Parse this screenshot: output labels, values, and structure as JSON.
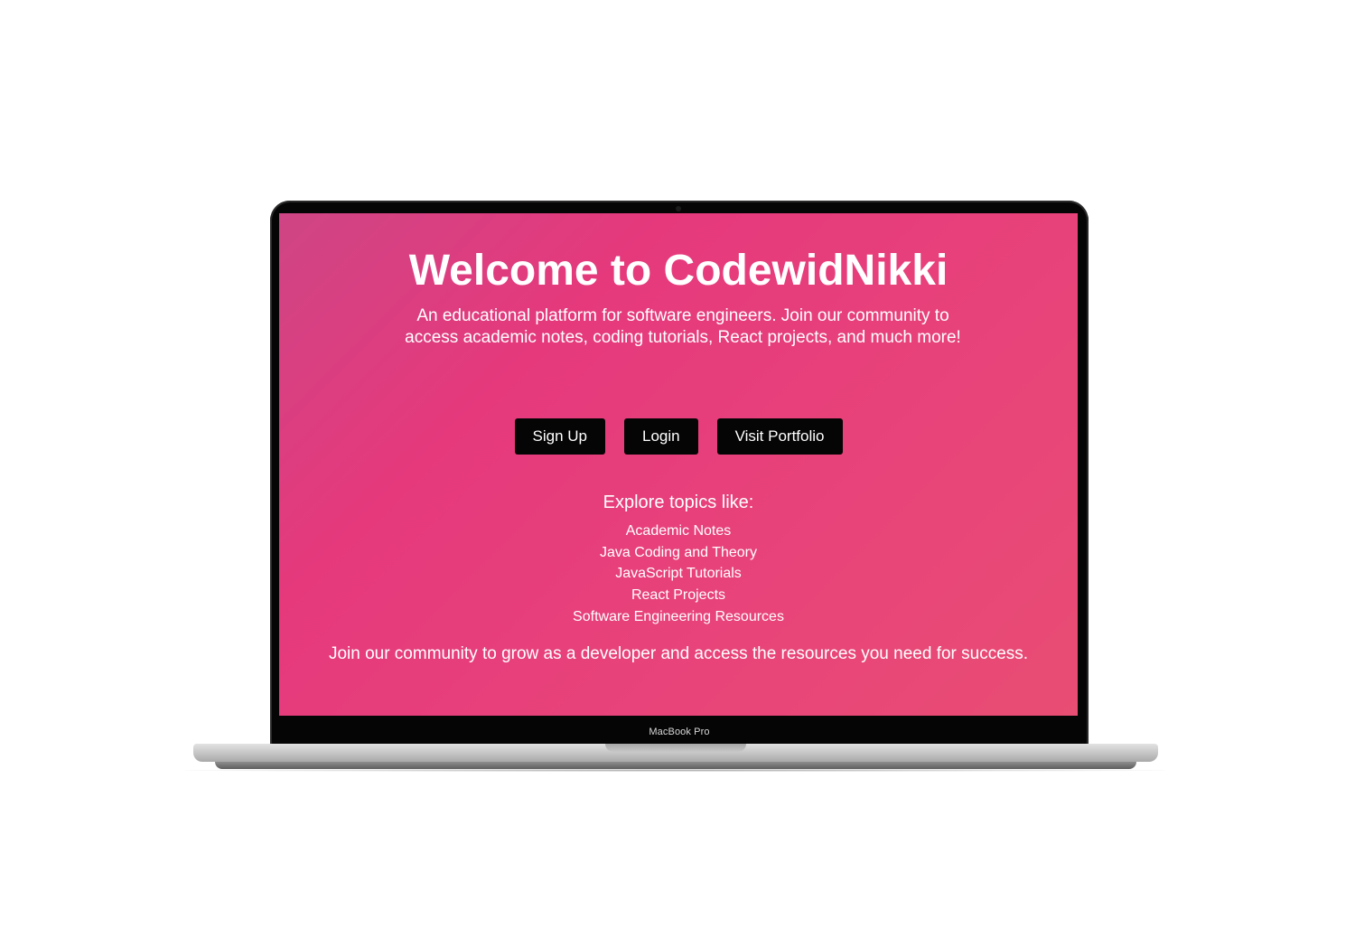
{
  "device": {
    "model_label": "MacBook Pro"
  },
  "hero": {
    "title": "Welcome to CodewidNikki",
    "subtitle": "An educational platform for software engineers. Join our community to access academic notes, coding tutorials, React projects, and much more!"
  },
  "buttons": {
    "sign_up": "Sign Up",
    "login": "Login",
    "visit_portfolio": "Visit Portfolio"
  },
  "topics": {
    "heading": "Explore topics like:",
    "items": [
      "Academic Notes",
      "Java Coding and Theory",
      "JavaScript Tutorials",
      "React Projects",
      "Software Engineering Resources"
    ]
  },
  "footer": {
    "text": "Join our community to grow as a developer and access the resources you need for success."
  },
  "colors": {
    "gradient_start": "#cf4585",
    "gradient_mid": "#e5397c",
    "gradient_end": "#e84d73",
    "button_bg": "#050505",
    "text": "#ffffff"
  }
}
